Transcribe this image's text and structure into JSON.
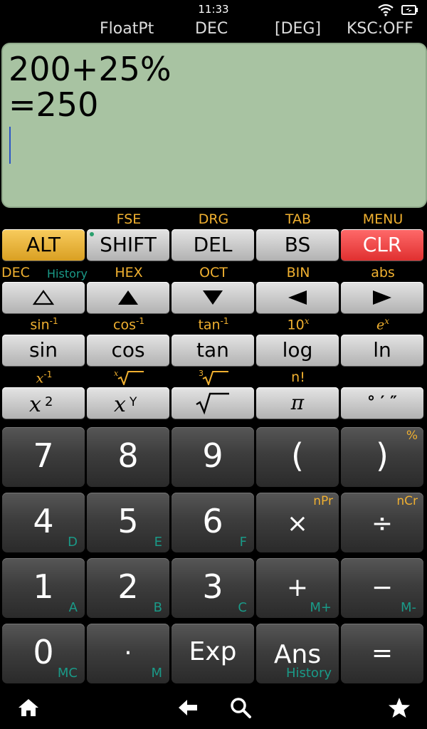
{
  "status": {
    "time": "11:33"
  },
  "modes": {
    "float": "FloatPt",
    "base": "DEC",
    "angle": "[DEG]",
    "ksc": "KSC:OFF"
  },
  "display": {
    "expression": "200+25%",
    "result": "=250"
  },
  "row1_labels": [
    "FSE",
    "DRG",
    "TAB",
    "MENU"
  ],
  "row1_keys": [
    "ALT",
    "SHIFT",
    "DEL",
    "BS",
    "CLR"
  ],
  "row2_labels": {
    "dec": "DEC",
    "history": "History",
    "hex": "HEX",
    "oct": "OCT",
    "bin": "BIN",
    "abs": "abs"
  },
  "row3_labels": {
    "asin": "sin",
    "acos": "cos",
    "atan": "tan",
    "pow10": "10",
    "exp": "e",
    "neg1": "-1",
    "x": "x"
  },
  "row3_keys": [
    "sin",
    "cos",
    "tan",
    "log",
    "ln"
  ],
  "row4_labels": {
    "inv": "x",
    "inv_sup": "-1",
    "fact": "n!"
  },
  "row4_keys": {
    "pi": "π",
    "dms": "° ′ ″"
  },
  "numpad": {
    "r1": [
      {
        "m": "7"
      },
      {
        "m": "8"
      },
      {
        "m": "9"
      },
      {
        "m": "("
      },
      {
        "m": ")",
        "o": "%"
      }
    ],
    "r2": [
      {
        "m": "4",
        "g": "D"
      },
      {
        "m": "5",
        "g": "E"
      },
      {
        "m": "6",
        "g": "F"
      },
      {
        "m": "×",
        "o": "nPr"
      },
      {
        "m": "÷",
        "o": "nCr"
      }
    ],
    "r3": [
      {
        "m": "1",
        "g": "A"
      },
      {
        "m": "2",
        "g": "B"
      },
      {
        "m": "3",
        "g": "C"
      },
      {
        "m": "+",
        "g": "M+"
      },
      {
        "m": "−",
        "g": "M-"
      }
    ],
    "r4": [
      {
        "m": "0",
        "g": "MC"
      },
      {
        "m": "·",
        "g": "M"
      },
      {
        "m": "Exp"
      },
      {
        "m": "Ans",
        "g": "History"
      },
      {
        "m": "="
      }
    ]
  },
  "colors": {
    "accent_orange": "#f0b030",
    "alt_key": "#f8cc5e",
    "clr_key": "#e03030",
    "display_bg": "#a8c3a2",
    "sub_green": "#1a9a88"
  },
  "icons": {
    "wifi": "wifi-icon",
    "battery": "battery-icon",
    "home": "home-icon",
    "back": "back-icon",
    "search": "search-icon",
    "star": "star-icon"
  }
}
